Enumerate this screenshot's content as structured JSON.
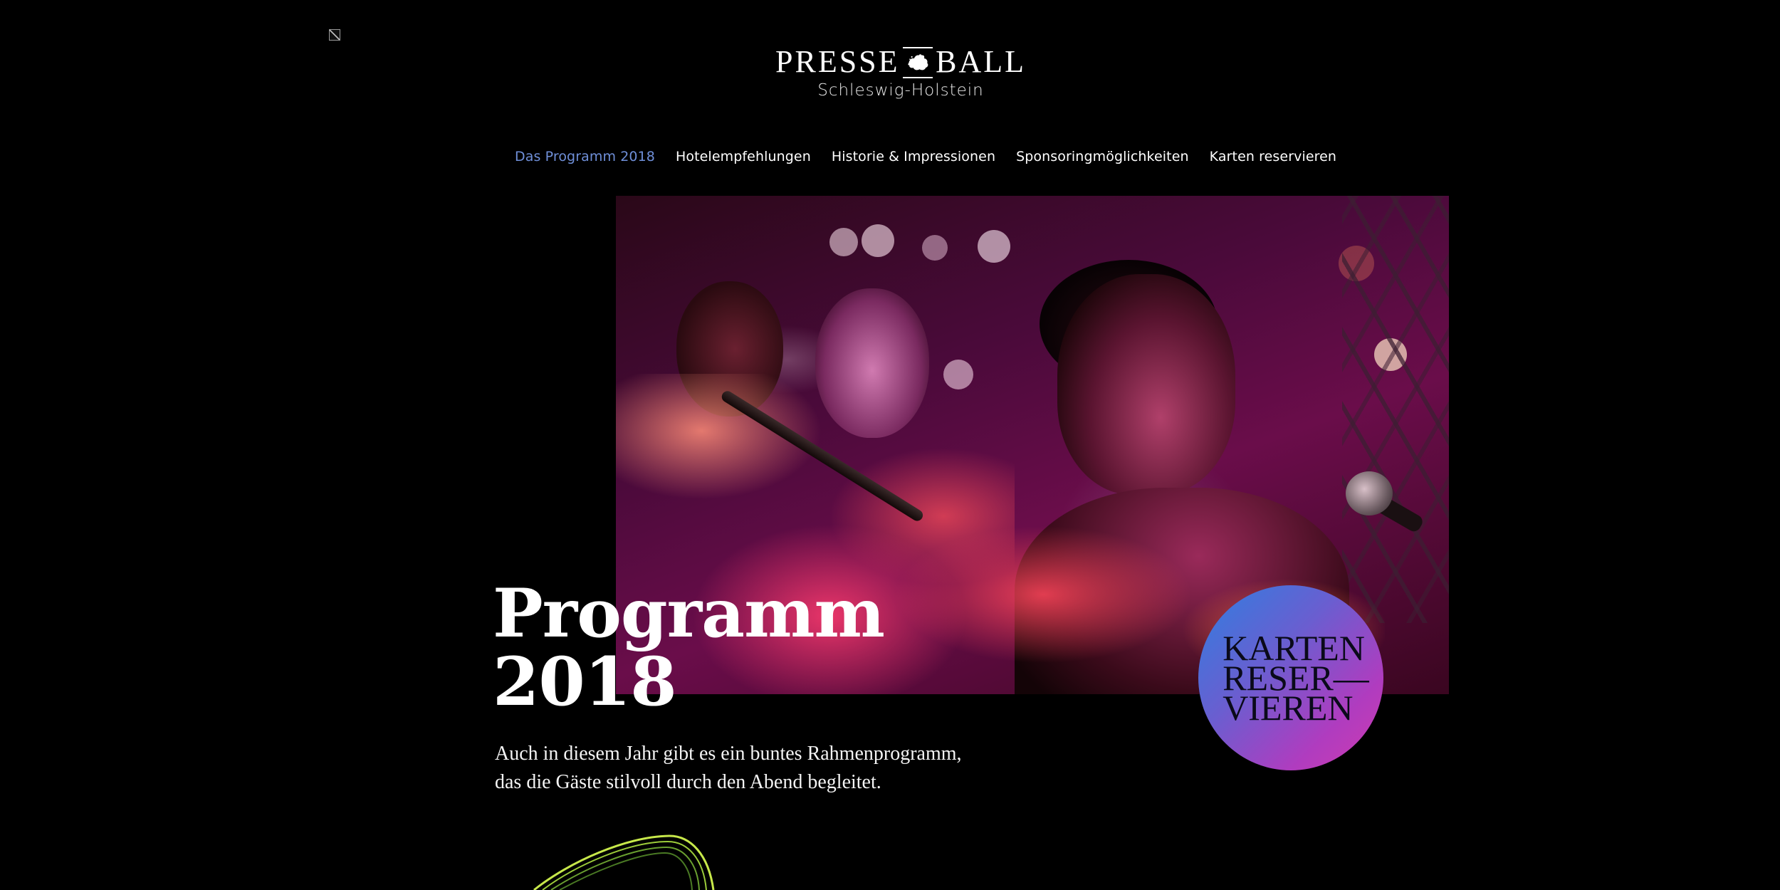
{
  "logo": {
    "word_left": "PRESSE",
    "word_right": "BALL",
    "subtitle": "Schleswig-Holstein"
  },
  "nav": {
    "items": [
      {
        "label": "Das Programm 2018",
        "active": true
      },
      {
        "label": "Hotelempfehlungen",
        "active": false
      },
      {
        "label": "Historie & Impressionen",
        "active": false
      },
      {
        "label": "Sponsoringmöglichkeiten",
        "active": false
      },
      {
        "label": "Karten reservieren",
        "active": false
      }
    ]
  },
  "hero": {
    "title_line1": "Programm",
    "title_line2": "2018",
    "intro_line1": "Auch in diesem Jahr gibt es ein buntes Rahmenprogramm,",
    "intro_line2": "das die Gäste stilvoll durch den Abend begleitet."
  },
  "cta": {
    "line1": "KARTEN",
    "line2": "RESER—",
    "line3": "VIEREN"
  },
  "colors": {
    "background": "#000000",
    "nav_active": "#6f8fd8",
    "cta_gradient_start": "#2e7fe0",
    "cta_gradient_end": "#d03ab0"
  }
}
